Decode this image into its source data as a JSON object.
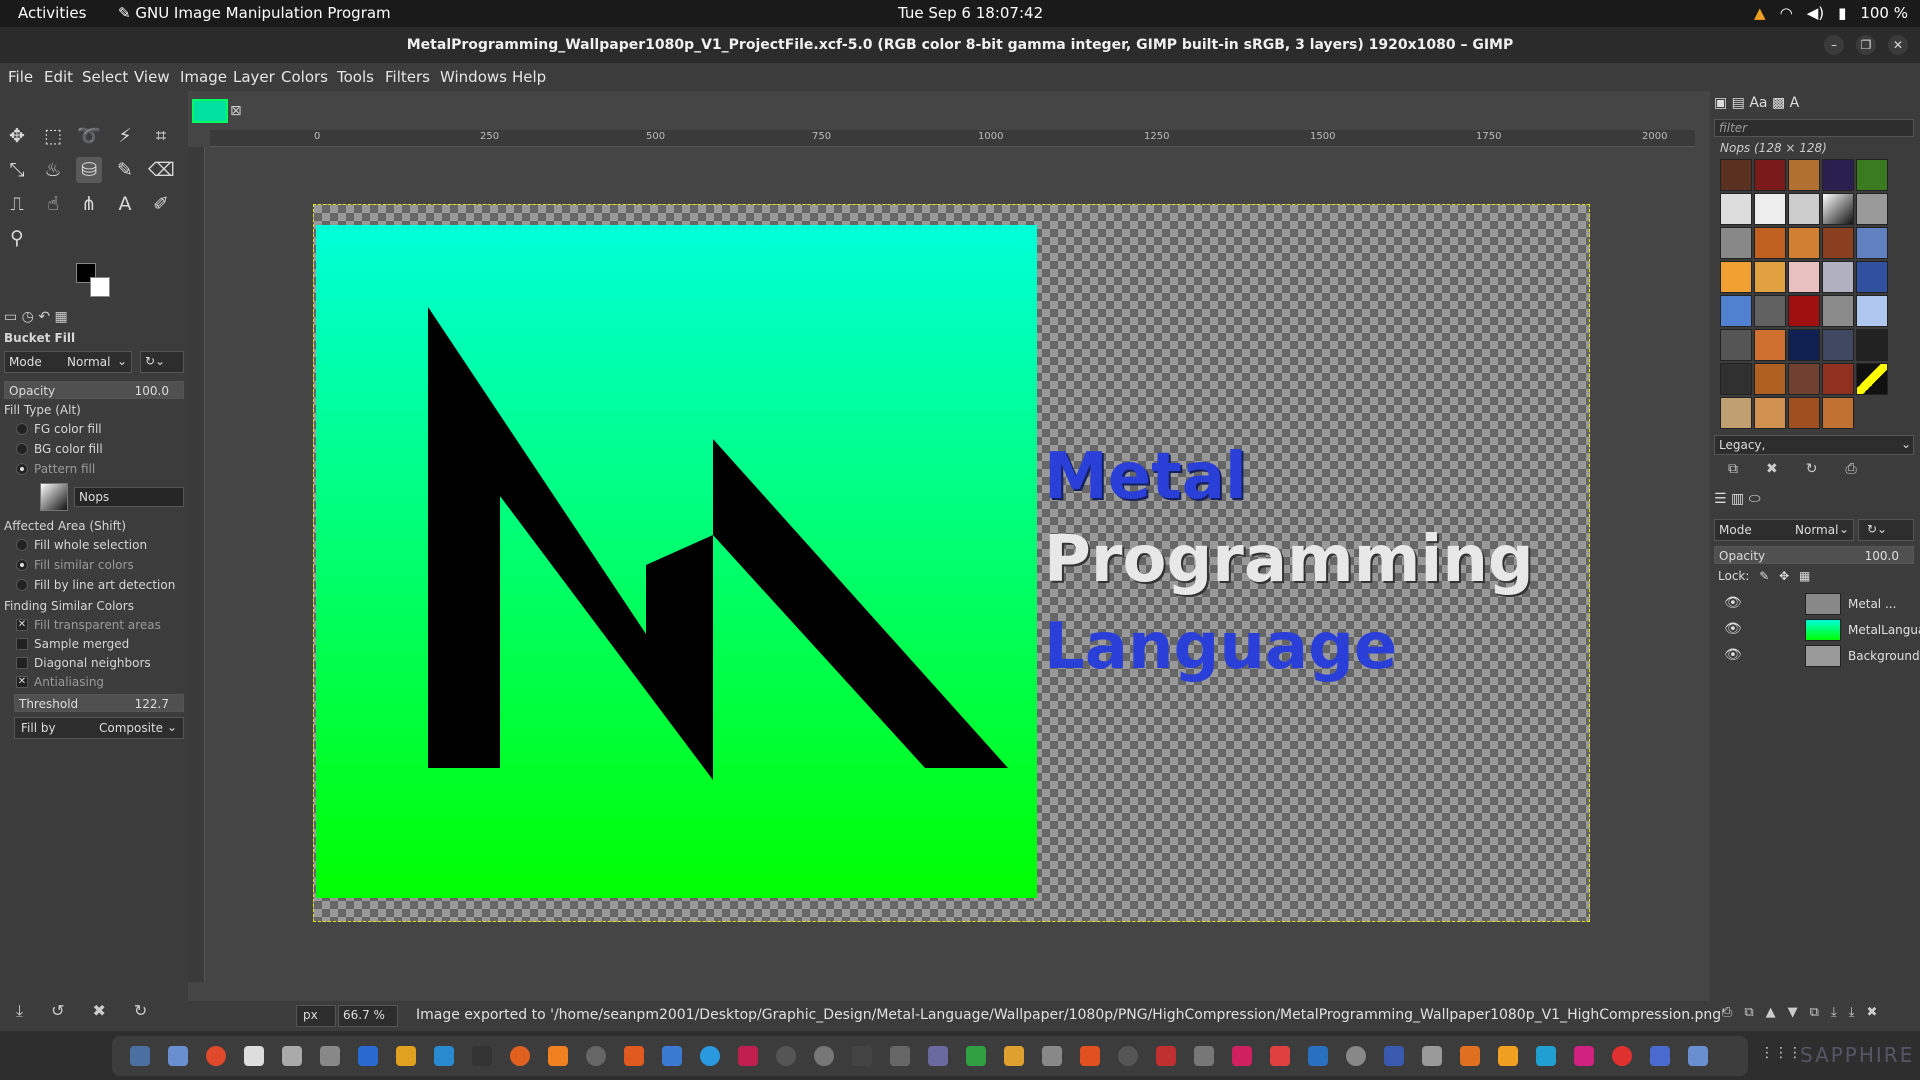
{
  "topbar": {
    "activities": "Activities",
    "app_name": "GNU Image Manipulation Program",
    "clock": "Tue Sep 6  18:07:42",
    "battery": "100 %"
  },
  "window": {
    "title": "MetalProgramming_Wallpaper1080p_V1_ProjectFile.xcf-5.0 (RGB color 8-bit gamma integer, GIMP built-in sRGB, 3 layers) 1920x1080 – GIMP"
  },
  "menu": [
    "File",
    "Edit",
    "Select",
    "View",
    "Image",
    "Layer",
    "Colors",
    "Tools",
    "Filters",
    "Windows",
    "Help"
  ],
  "ruler_ticks": [
    "0",
    "250",
    "500",
    "750",
    "1000",
    "1250",
    "1500",
    "1750",
    "2000"
  ],
  "tool_options": {
    "title": "Bucket Fill",
    "mode_label": "Mode",
    "mode_value": "Normal",
    "opacity_label": "Opacity",
    "opacity_value": "100.0",
    "fill_type_label": "Fill Type  (Alt)",
    "fill_types": [
      "FG color fill",
      "BG color fill",
      "Pattern fill"
    ],
    "fill_type_selected": "Pattern fill",
    "pattern_name": "Nops",
    "affected_area_label": "Affected Area  (Shift)",
    "affected_areas": [
      "Fill whole selection",
      "Fill similar colors",
      "Fill by line art detection"
    ],
    "finding_label": "Finding Similar Colors",
    "finding_options": [
      {
        "label": "Fill transparent areas",
        "checked": true
      },
      {
        "label": "Sample merged",
        "checked": false
      },
      {
        "label": "Diagonal neighbors",
        "checked": false
      },
      {
        "label": "Antialiasing",
        "checked": true
      }
    ],
    "threshold_label": "Threshold",
    "threshold_value": "122.7",
    "fill_by_label": "Fill by",
    "fill_by_value": "Composite"
  },
  "image_text": {
    "line1": "Metal",
    "line2": "Programming",
    "line3": "Language"
  },
  "patterns_panel": {
    "filter_placeholder": "filter",
    "heading": "Nops (128 × 128)",
    "tag": "Legacy,"
  },
  "layers_panel": {
    "mode_label": "Mode",
    "mode_value": "Normal",
    "opacity_label": "Opacity",
    "opacity_value": "100.0",
    "lock_label": "Lock:",
    "layers": [
      "Metal ...",
      "MetalLanguage",
      "Background"
    ]
  },
  "statusbar": {
    "unit": "px",
    "zoom": "66.7 %",
    "message": "Image exported to '/home/seanpm2001/Desktop/Graphic_Design/Metal-Language/Wallpaper/1080p/PNG/HighCompression/MetalProgramming_Wallpaper1080p_V1_HighCompression.png'"
  },
  "colors": {
    "logo_top": "#00ffd8",
    "logo_bottom": "#00ff00",
    "text_metal": "#2a3fd8",
    "text_language": "#2a3fd8"
  },
  "taskbar": {
    "brand": "SAPPHIRE"
  }
}
